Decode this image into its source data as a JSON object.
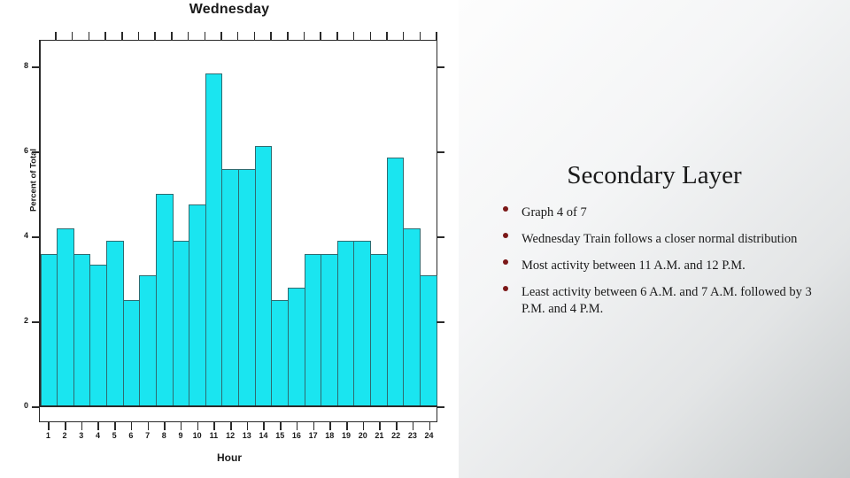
{
  "slide": {
    "decor_marks": [
      "grey-mark",
      "pink-mark"
    ]
  },
  "chart": {
    "title": "Wednesday",
    "xlabel": "Hour",
    "ylabel": "Percent of Total",
    "bar_color": "#1ae5f0",
    "bar_border_color": "#2f6b70"
  },
  "text_panel": {
    "title": "Secondary Layer",
    "bullets": [
      "Graph 4 of 7",
      "Wednesday Train follows a closer normal distribution",
      "Most activity between 11 A.M. and 12 P.M.",
      "Least activity between 6 A.M. and 7 A.M. followed by 3 P.M. and 4 P.M."
    ],
    "bullet_color": "#7b1818"
  },
  "chart_data": {
    "type": "bar",
    "title": "Wednesday",
    "xlabel": "Hour",
    "ylabel": "Percent of Total",
    "categories": [
      "1",
      "2",
      "3",
      "4",
      "5",
      "6",
      "7",
      "8",
      "9",
      "10",
      "11",
      "12",
      "13",
      "14",
      "15",
      "16",
      "17",
      "18",
      "19",
      "20",
      "21",
      "22",
      "23",
      "24"
    ],
    "values": [
      3.6,
      4.2,
      3.6,
      3.35,
      3.9,
      2.5,
      3.1,
      5.0,
      3.9,
      4.75,
      7.85,
      5.6,
      5.6,
      6.13,
      2.5,
      2.8,
      3.6,
      3.6,
      3.9,
      3.9,
      3.6,
      5.87,
      4.2,
      3.1
    ],
    "ylim": [
      0,
      8.6
    ],
    "yticks": [
      0,
      2,
      4,
      6,
      8
    ],
    "xlim_categories": 24,
    "grid": false,
    "legend": false
  }
}
